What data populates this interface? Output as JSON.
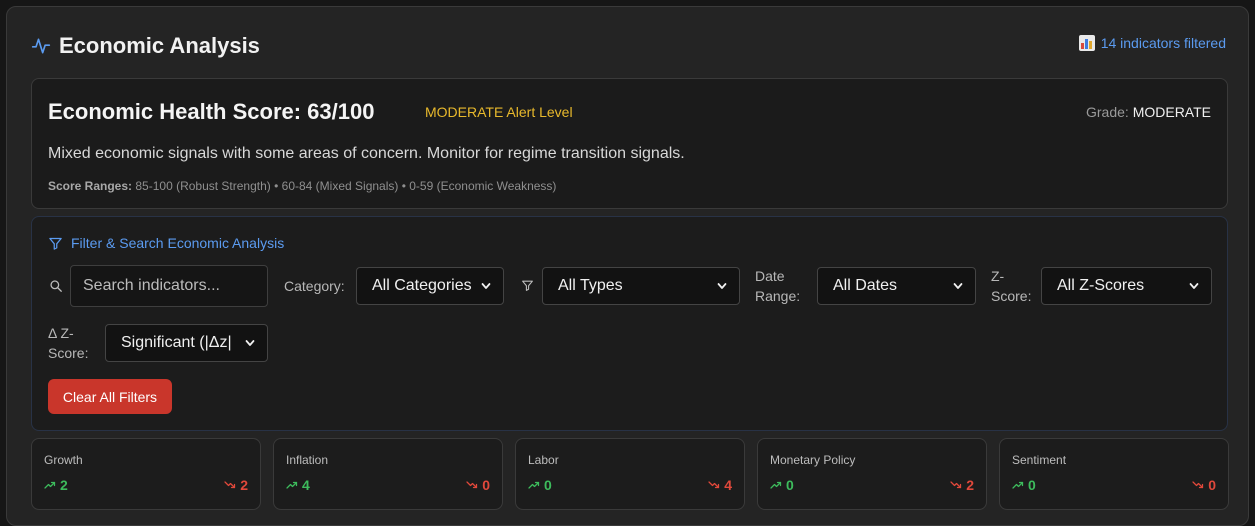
{
  "header": {
    "title": "Economic Analysis",
    "filtered_text": "14 indicators filtered"
  },
  "score": {
    "title": "Economic Health Score: 63/100",
    "alert_level": "MODERATE Alert Level",
    "grade_label": "Grade:",
    "grade_value": "MODERATE",
    "description": "Mixed economic signals with some areas of concern. Monitor for regime transition signals.",
    "ranges_label": "Score Ranges:",
    "ranges_text": "85-100 (Robust Strength) • 60-84 (Mixed Signals) • 0-59 (Economic Weakness)"
  },
  "filters": {
    "heading": "Filter & Search Economic Analysis",
    "search_placeholder": "Search indicators...",
    "category_label": "Category:",
    "category_value": "All Categories",
    "type_value": "All Types",
    "date_label_1": "Date",
    "date_label_2": "Range:",
    "date_value": "All Dates",
    "z_label_1": "Z-",
    "z_label_2": "Score:",
    "z_value": "All Z-Scores",
    "dz_label_1": "Δ Z-",
    "dz_label_2": "Score:",
    "dz_value": "Significant (|Δz|",
    "clear_label": "Clear All Filters"
  },
  "categories": [
    {
      "name": "Growth",
      "up": "2",
      "down": "2"
    },
    {
      "name": "Inflation",
      "up": "4",
      "down": "0"
    },
    {
      "name": "Labor",
      "up": "0",
      "down": "4"
    },
    {
      "name": "Monetary Policy",
      "up": "0",
      "down": "2"
    },
    {
      "name": "Sentiment",
      "up": "0",
      "down": "0"
    }
  ],
  "colors": {
    "accent_blue": "#5b9bf0",
    "alert_yellow": "#e8b92c",
    "up_green": "#3dbb5c",
    "down_red": "#e0483b",
    "clear_button": "#c9362b"
  }
}
